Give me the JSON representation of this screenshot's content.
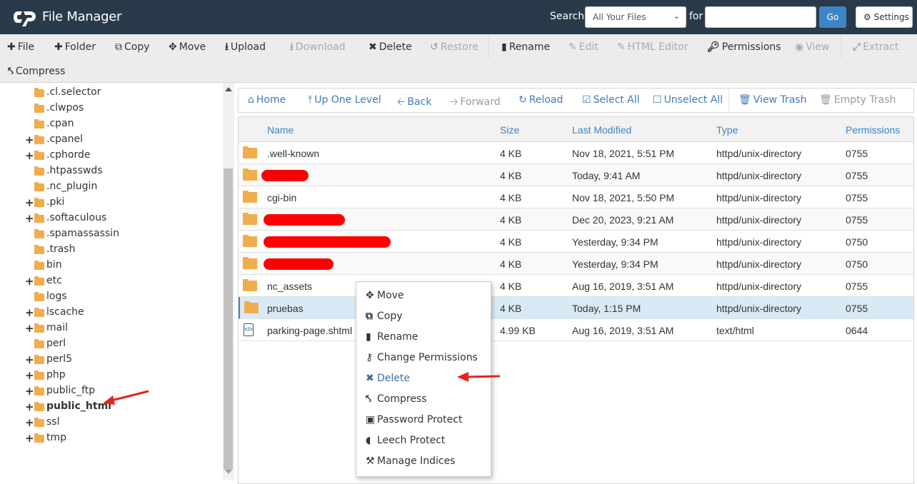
{
  "header": {
    "title": "File Manager",
    "search_label": "Search",
    "search_scope": "All Your Files",
    "for_label": "for",
    "search_value": "",
    "go_label": "Go",
    "settings_label": "Settings"
  },
  "toolbar": {
    "items": [
      {
        "label": "File",
        "icon": "plus-icon",
        "enabled": true
      },
      {
        "label": "Folder",
        "icon": "plus-icon",
        "enabled": true
      },
      {
        "label": "Copy",
        "icon": "copy-icon",
        "enabled": true
      },
      {
        "label": "Move",
        "icon": "move-icon",
        "enabled": true
      },
      {
        "label": "Upload",
        "icon": "upload-icon",
        "enabled": true
      },
      {
        "label": "Download",
        "icon": "download-icon",
        "enabled": false
      },
      {
        "label": "Delete",
        "icon": "times-icon",
        "enabled": true
      },
      {
        "label": "Restore",
        "icon": "undo-icon",
        "enabled": false
      },
      {
        "label": "Rename",
        "icon": "file-icon",
        "enabled": true
      },
      {
        "label": "Edit",
        "icon": "pencil-icon",
        "enabled": false
      },
      {
        "label": "HTML Editor",
        "icon": "edit-icon",
        "enabled": false
      },
      {
        "label": "Permissions",
        "icon": "key-icon",
        "enabled": true
      },
      {
        "label": "View",
        "icon": "eye-icon",
        "enabled": false
      },
      {
        "label": "Extract",
        "icon": "expand-icon",
        "enabled": false
      },
      {
        "label": "Compress",
        "icon": "compress-icon",
        "enabled": true
      }
    ]
  },
  "tree": {
    "items": [
      {
        "label": ".cl.selector",
        "expandable": false,
        "bold": false
      },
      {
        "label": ".clwpos",
        "expandable": false,
        "bold": false
      },
      {
        "label": ".cpan",
        "expandable": false,
        "bold": false
      },
      {
        "label": ".cpanel",
        "expandable": true,
        "bold": false
      },
      {
        "label": ".cphorde",
        "expandable": true,
        "bold": false
      },
      {
        "label": ".htpasswds",
        "expandable": false,
        "bold": false
      },
      {
        "label": ".nc_plugin",
        "expandable": false,
        "bold": false
      },
      {
        "label": ".pki",
        "expandable": true,
        "bold": false
      },
      {
        "label": ".softaculous",
        "expandable": true,
        "bold": false
      },
      {
        "label": ".spamassassin",
        "expandable": false,
        "bold": false
      },
      {
        "label": ".trash",
        "expandable": false,
        "bold": false
      },
      {
        "label": "bin",
        "expandable": false,
        "bold": false
      },
      {
        "label": "etc",
        "expandable": true,
        "bold": false
      },
      {
        "label": "logs",
        "expandable": false,
        "bold": false
      },
      {
        "label": "lscache",
        "expandable": true,
        "bold": false
      },
      {
        "label": "mail",
        "expandable": true,
        "bold": false
      },
      {
        "label": "perl",
        "expandable": false,
        "bold": false
      },
      {
        "label": "perl5",
        "expandable": true,
        "bold": false
      },
      {
        "label": "php",
        "expandable": true,
        "bold": false
      },
      {
        "label": "public_ftp",
        "expandable": true,
        "bold": false
      },
      {
        "label": "public_html",
        "expandable": true,
        "bold": true
      },
      {
        "label": "ssl",
        "expandable": true,
        "bold": false
      },
      {
        "label": "tmp",
        "expandable": true,
        "bold": false
      }
    ],
    "expand_symbol": "+"
  },
  "nav": {
    "items": [
      {
        "label": "Home",
        "icon": "home-icon",
        "enabled": true
      },
      {
        "label": "Up One Level",
        "icon": "level-up-icon",
        "enabled": true
      },
      {
        "label": "Back",
        "icon": "arrow-left-icon",
        "enabled": true
      },
      {
        "label": "Forward",
        "icon": "arrow-right-icon",
        "enabled": false
      },
      {
        "label": "Reload",
        "icon": "refresh-icon",
        "enabled": true
      },
      {
        "label": "Select All",
        "icon": "check-square-icon",
        "enabled": true
      },
      {
        "label": "Unselect All",
        "icon": "square-icon",
        "enabled": true
      },
      {
        "label": "View Trash",
        "icon": "trash-icon",
        "enabled": true
      },
      {
        "label": "Empty Trash",
        "icon": "trash-icon",
        "enabled": false
      }
    ]
  },
  "table": {
    "columns": [
      "Name",
      "Size",
      "Last Modified",
      "Type",
      "Permissions"
    ],
    "rows": [
      {
        "name": ".well-known",
        "redacted": false,
        "size": "4 KB",
        "modified": "Nov 18, 2021, 5:51 PM",
        "type": "httpd/unix-directory",
        "perms": "0755",
        "kind": "folder",
        "selected": false
      },
      {
        "name": "",
        "redacted": true,
        "size": "4 KB",
        "modified": "Today, 9:41 AM",
        "type": "httpd/unix-directory",
        "perms": "0755",
        "kind": "folder",
        "selected": false
      },
      {
        "name": "cgi-bin",
        "redacted": false,
        "size": "4 KB",
        "modified": "Nov 18, 2021, 5:50 PM",
        "type": "httpd/unix-directory",
        "perms": "0755",
        "kind": "folder",
        "selected": false
      },
      {
        "name": "",
        "redacted": true,
        "size": "4 KB",
        "modified": "Dec 20, 2023, 9:21 AM",
        "type": "httpd/unix-directory",
        "perms": "0755",
        "kind": "folder",
        "selected": false
      },
      {
        "name": "",
        "redacted": true,
        "size": "4 KB",
        "modified": "Yesterday, 9:34 PM",
        "type": "httpd/unix-directory",
        "perms": "0750",
        "kind": "folder",
        "selected": false
      },
      {
        "name": "",
        "redacted": true,
        "size": "4 KB",
        "modified": "Yesterday, 9:34 PM",
        "type": "httpd/unix-directory",
        "perms": "0750",
        "kind": "folder",
        "selected": false
      },
      {
        "name": "nc_assets",
        "redacted": false,
        "size": "4 KB",
        "modified": "Aug 16, 2019, 3:51 AM",
        "type": "httpd/unix-directory",
        "perms": "0755",
        "kind": "folder",
        "selected": false
      },
      {
        "name": "pruebas",
        "redacted": false,
        "size": "4 KB",
        "modified": "Today, 1:15 PM",
        "type": "httpd/unix-directory",
        "perms": "0755",
        "kind": "folder",
        "selected": true
      },
      {
        "name": "parking-page.shtml",
        "redacted": false,
        "size": "4.99 KB",
        "modified": "Aug 16, 2019, 3:51 AM",
        "type": "text/html",
        "perms": "0644",
        "kind": "html-file",
        "selected": false
      }
    ]
  },
  "context_menu": {
    "items": [
      {
        "label": "Move",
        "icon": "move-icon",
        "active": false
      },
      {
        "label": "Copy",
        "icon": "copy-icon",
        "active": false
      },
      {
        "label": "Rename",
        "icon": "file-icon",
        "active": false
      },
      {
        "label": "Change Permissions",
        "icon": "key-icon",
        "active": false
      },
      {
        "label": "Delete",
        "icon": "times-icon",
        "active": true
      },
      {
        "label": "Compress",
        "icon": "compress-icon",
        "active": false
      },
      {
        "label": "Password Protect",
        "icon": "lock-icon",
        "active": false
      },
      {
        "label": "Leech Protect",
        "icon": "shield-icon",
        "active": false
      },
      {
        "label": "Manage Indices",
        "icon": "wrench-icon",
        "active": false
      }
    ]
  },
  "colors": {
    "header_bg": "#293a4a",
    "accent": "#3d85c6",
    "folder": "#f0ad4e",
    "selected_row": "#d9eaf7",
    "annotation_arrow": "#e8231e",
    "redaction": "#ff0000"
  }
}
